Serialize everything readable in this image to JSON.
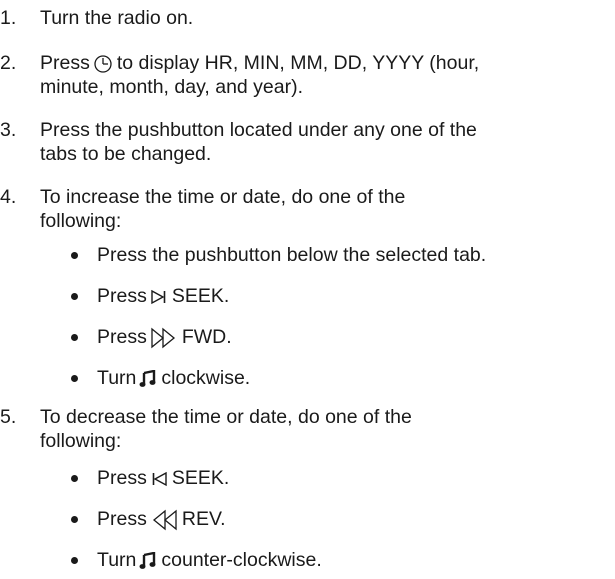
{
  "steps": [
    {
      "num": "1.",
      "line1": "Turn the radio on."
    },
    {
      "num": "2.",
      "line1_pre": "Press",
      "line1_post": "to display HR, MIN, MM, DD, YYYY (hour,",
      "line2": "minute, month, day, and year).",
      "icon": "clock-icon"
    },
    {
      "num": "3.",
      "line1": "Press the pushbutton located under any one of the",
      "line2": "tabs to be changed."
    },
    {
      "num": "4.",
      "line1": "To increase the time or date, do one of the",
      "line2": "following:"
    },
    {
      "num": "5.",
      "line1": "To decrease the time or date, do one of the",
      "line2": "following:"
    }
  ],
  "increase_bullets": [
    {
      "text": "Press the pushbutton below the selected tab."
    },
    {
      "pre": "Press",
      "post": "SEEK.",
      "icon": "seek-forward-icon"
    },
    {
      "pre": "Press",
      "post": "FWD.",
      "icon": "fast-forward-icon"
    },
    {
      "pre": "Turn",
      "post": "clockwise.",
      "icon": "music-note-icon"
    }
  ],
  "decrease_bullets": [
    {
      "pre": "Press",
      "post": "SEEK.",
      "icon": "seek-back-icon"
    },
    {
      "pre": "Press",
      "post": "REV.",
      "icon": "rewind-icon"
    },
    {
      "pre": "Turn",
      "post": "counter-clockwise.",
      "icon": "music-note-icon"
    }
  ]
}
